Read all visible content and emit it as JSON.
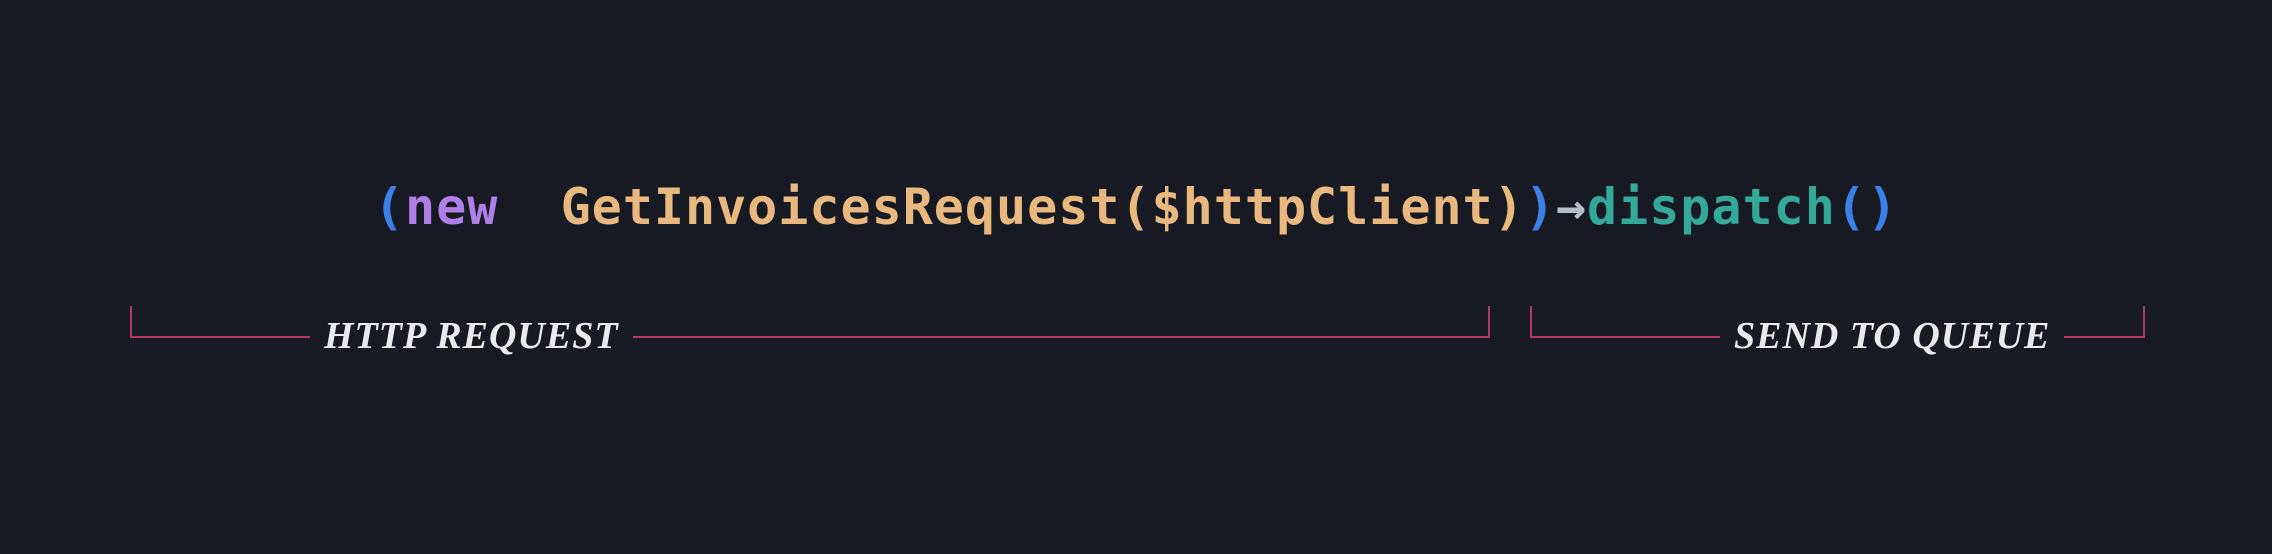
{
  "code": {
    "paren_open_outer": "(",
    "new_keyword": "new ",
    "class_name": " GetInvoicesRequest",
    "paren_open_inner": "(",
    "variable": "$httpClient",
    "paren_close_inner": ")",
    "paren_close_outer": ")",
    "arrow": "→",
    "method": "dispatch",
    "call_open": "(",
    "call_close": ")"
  },
  "annotations": {
    "http_request": "HTTP Request",
    "send_to_queue": "Send to queue"
  },
  "colors": {
    "background": "#171a23",
    "paren_outer": "#3b80e8",
    "paren_inner": "#e8b87f",
    "keyword_new": "#b07ee8",
    "class_name": "#e8b87f",
    "variable": "#e8b87f",
    "method": "#34a99a",
    "arrow": "#b5bdc9",
    "bracket": "#b8365c",
    "label_text": "#e9eaec"
  }
}
